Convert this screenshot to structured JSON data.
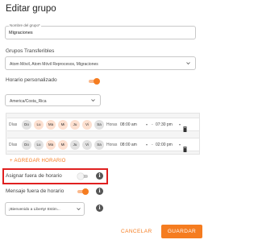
{
  "dialog": {
    "title": "Editar grupo"
  },
  "group_name": {
    "label": "Nombre del grupo*",
    "value": "Migraciones"
  },
  "transferable_groups": {
    "label": "Grupos Transferibles",
    "value": "Atom Móvil, Atom Móvil Reprocesos, Migraciones"
  },
  "custom_schedule": {
    "label": "Horario personalizado",
    "enabled": true
  },
  "timezone": {
    "value": "America/Costa_Rica"
  },
  "schedules": [
    {
      "days_label": "Días",
      "days": [
        {
          "label": "Do",
          "selected": true
        },
        {
          "label": "Lu",
          "selected": false
        },
        {
          "label": "Ma",
          "selected": false
        },
        {
          "label": "Mi",
          "selected": false
        },
        {
          "label": "Ju",
          "selected": false
        },
        {
          "label": "Vi",
          "selected": false
        },
        {
          "label": "Sa",
          "selected": true
        }
      ],
      "hours_label": "Horas",
      "start": "08:00 am",
      "end": "07:30 pm"
    },
    {
      "days_label": "Días",
      "days": [
        {
          "label": "Do",
          "selected": true
        },
        {
          "label": "Lu",
          "selected": true
        },
        {
          "label": "Ma",
          "selected": false
        },
        {
          "label": "Mi",
          "selected": false
        },
        {
          "label": "Ju",
          "selected": true
        },
        {
          "label": "Vi",
          "selected": true
        },
        {
          "label": "Sa",
          "selected": true
        }
      ],
      "hours_label": "Horas",
      "start": "08:00 am",
      "end": "02:00 pm"
    }
  ],
  "add_schedule": {
    "label": "+ AGREGAR HORARIO"
  },
  "assign_out_of_hours": {
    "label": "Asignar fuera de horario",
    "enabled": false
  },
  "out_of_hours_message": {
    "label": "Mensaje fuera de horario",
    "enabled": true,
    "value": "¡Bienvenido a Liberty! Estim..."
  },
  "actions": {
    "cancel": "CANCELAR",
    "save": "GUARDAR"
  },
  "colors": {
    "accent": "#f57c20",
    "highlight": "#e02020"
  }
}
